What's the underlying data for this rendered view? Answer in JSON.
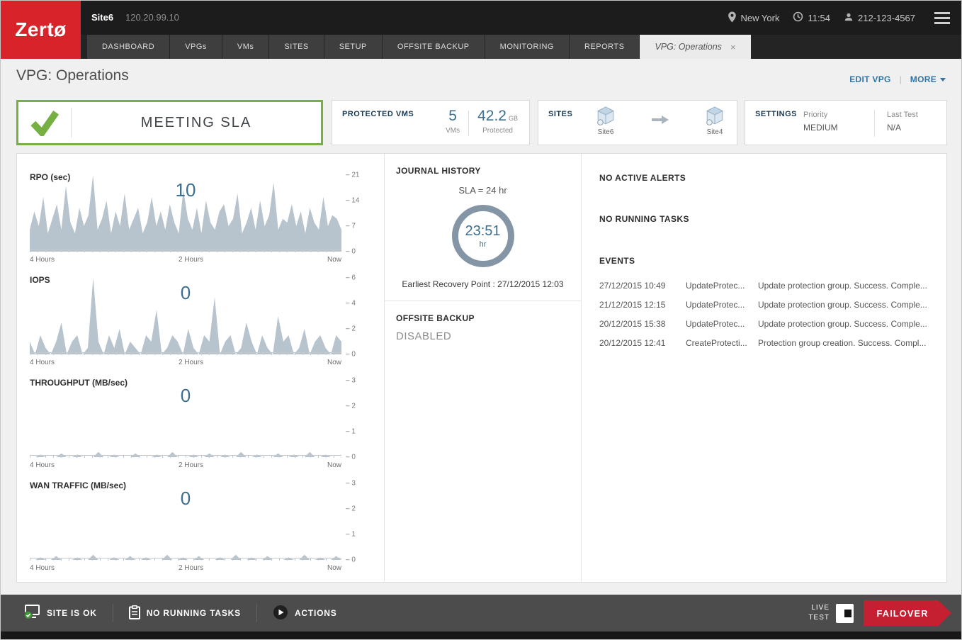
{
  "topbar": {
    "logo": "Zertø",
    "site_name": "Site6",
    "site_ip": "120.20.99.10",
    "location": "New York",
    "time": "11:54",
    "phone": "212-123-4567"
  },
  "nav": {
    "tabs": [
      "DASHBOARD",
      "VPGs",
      "VMs",
      "SITES",
      "SETUP",
      "OFFSITE BACKUP",
      "MONITORING",
      "REPORTS"
    ],
    "active_tab": "VPG: Operations",
    "close_label": "×"
  },
  "header": {
    "title": "VPG: Operations",
    "edit_vpg": "EDIT VPG",
    "divider": "|",
    "more": "MORE"
  },
  "status": {
    "sla_text": "MEETING SLA",
    "protected_vms": {
      "label": "PROTECTED VMS",
      "vm_count": "5",
      "vm_unit": "VMs",
      "size_value": "42.2",
      "size_unit": "GB",
      "size_caption": "Protected"
    },
    "sites": {
      "label": "SITES",
      "source": "Site6",
      "target": "Site4"
    },
    "settings": {
      "label": "SETTINGS",
      "priority_label": "Priority",
      "priority_value": "MEDIUM",
      "last_test_label": "Last Test",
      "last_test_value": "N/A"
    }
  },
  "journal": {
    "title": "JOURNAL HISTORY",
    "sla_line": "SLA = 24 hr",
    "gauge_value": "23:51",
    "gauge_unit": "hr",
    "earliest_recovery": "Earliest Recovery Point : 27/12/2015 12:03"
  },
  "offsite_backup": {
    "title": "OFFSITE BACKUP",
    "status": "DISABLED"
  },
  "alerts": {
    "no_alerts": "NO ACTIVE ALERTS",
    "no_tasks": "NO RUNNING TASKS"
  },
  "events": {
    "title": "EVENTS",
    "rows": [
      {
        "timestamp": "27/12/2015 10:49",
        "type": "UpdateProtec...",
        "description": "Update protection group. Success. Comple..."
      },
      {
        "timestamp": "21/12/2015 12:15",
        "type": "UpdateProtec...",
        "description": "Update protection group. Success. Comple..."
      },
      {
        "timestamp": "20/12/2015 15:38",
        "type": "UpdateProtec...",
        "description": "Update protection group. Success. Comple..."
      },
      {
        "timestamp": "20/12/2015 12:41",
        "type": "CreateProtecti...",
        "description": "Protection group creation. Success. Compl..."
      }
    ]
  },
  "footer": {
    "site_status": "SITE IS OK",
    "tasks": "NO RUNNING TASKS",
    "actions": "ACTIONS",
    "live_label": "LIVE",
    "test_label": "TEST",
    "failover_label": "FAILOVER"
  },
  "colors": {
    "brand_red": "#d8232a",
    "sla_green": "#76b043",
    "accent_blue": "#3c6e8f",
    "chart_fill": "#b7c3cd",
    "gauge_ring": "#8496a6",
    "failover_red": "#c42032"
  },
  "chart_data": [
    {
      "type": "area",
      "title": "RPO (sec)",
      "current": "10",
      "xlabels": [
        "4 Hours",
        "2 Hours",
        "Now"
      ],
      "yticks": [
        21,
        14,
        7,
        0
      ],
      "ylim": [
        0,
        21
      ],
      "values": [
        6,
        11,
        7,
        15,
        5,
        9,
        13,
        6,
        18,
        8,
        5,
        12,
        7,
        10,
        21,
        6,
        9,
        14,
        5,
        11,
        7,
        16,
        6,
        9,
        12,
        5,
        8,
        15,
        7,
        11,
        6,
        13,
        8,
        5,
        17,
        9,
        6,
        12,
        5,
        14,
        8,
        6,
        11,
        13,
        7,
        9,
        16,
        5,
        8,
        12,
        6,
        14,
        7,
        10,
        19,
        6,
        9,
        8,
        13,
        7,
        11,
        5,
        12,
        8,
        6,
        15,
        7,
        10,
        9,
        6
      ]
    },
    {
      "type": "area",
      "title": "IOPS",
      "current": "0",
      "xlabels": [
        "4 Hours",
        "2 Hours",
        "Now"
      ],
      "yticks": [
        6,
        4,
        2,
        0
      ],
      "ylim": [
        0,
        6
      ],
      "values": [
        1,
        0,
        1.5,
        0.5,
        0,
        1,
        2.5,
        0,
        1,
        1.5,
        0,
        0.5,
        6,
        1,
        0,
        1.5,
        0.5,
        2,
        0,
        1,
        0.5,
        0,
        1.5,
        1,
        3.5,
        0,
        0.5,
        1.5,
        1,
        0,
        2,
        0.5,
        0,
        1.5,
        1,
        4.5,
        0,
        1,
        1.5,
        0,
        0.5,
        2.5,
        1,
        0,
        1.5,
        0.5,
        0,
        3,
        1,
        1.5,
        0,
        0.5,
        2,
        0,
        1,
        1.5,
        0.5,
        0,
        1.5,
        1
      ]
    },
    {
      "type": "area",
      "title": "THROUGHPUT (MB/sec)",
      "current": "0",
      "xlabels": [
        "4 Hours",
        "2 Hours",
        "Now"
      ],
      "yticks": [
        3,
        2,
        1,
        0
      ],
      "ylim": [
        0,
        3
      ],
      "values": [
        0,
        0,
        0.1,
        0,
        0,
        0,
        0.15,
        0,
        0,
        0.1,
        0,
        0,
        0,
        0.2,
        0,
        0,
        0.1,
        0,
        0,
        0,
        0.15,
        0,
        0,
        0,
        0.1,
        0,
        0,
        0.2,
        0,
        0,
        0,
        0.1,
        0,
        0,
        0.15,
        0,
        0,
        0.1,
        0,
        0,
        0.2,
        0,
        0,
        0.1,
        0,
        0,
        0,
        0.15,
        0,
        0,
        0.1,
        0,
        0,
        0.2,
        0,
        0,
        0.1,
        0,
        0,
        0
      ]
    },
    {
      "type": "area",
      "title": "WAN TRAFFIC (MB/sec)",
      "current": "0",
      "xlabels": [
        "4 Hours",
        "2 Hours",
        "Now"
      ],
      "yticks": [
        3,
        2,
        1,
        0
      ],
      "ylim": [
        0,
        3
      ],
      "values": [
        0,
        0,
        0.1,
        0,
        0,
        0.15,
        0,
        0,
        0,
        0.1,
        0,
        0,
        0.2,
        0,
        0,
        0,
        0.1,
        0,
        0,
        0.15,
        0,
        0,
        0.1,
        0,
        0,
        0,
        0.2,
        0,
        0,
        0.1,
        0,
        0,
        0.15,
        0,
        0,
        0,
        0.1,
        0,
        0,
        0.2,
        0,
        0,
        0.1,
        0,
        0,
        0.15,
        0,
        0,
        0,
        0.1,
        0,
        0,
        0.2,
        0,
        0,
        0.1,
        0,
        0,
        0.15,
        0
      ]
    }
  ]
}
